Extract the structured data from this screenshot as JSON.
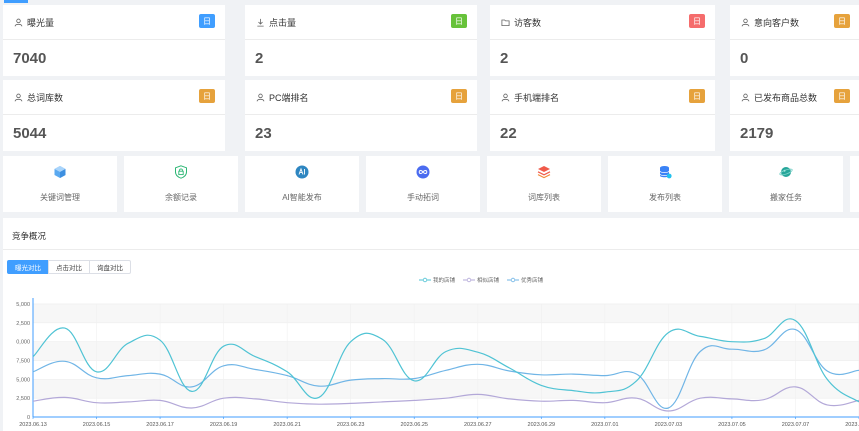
{
  "stats": [
    {
      "label": "曝光量",
      "badge": "日",
      "value": "7040",
      "icon": "user-icon",
      "badge_color": "#409eff"
    },
    {
      "label": "点击量",
      "badge": "日",
      "value": "2",
      "icon": "download-icon",
      "badge_color": "#67c23a"
    },
    {
      "label": "访客数",
      "badge": "日",
      "value": "2",
      "icon": "folder-icon",
      "badge_color": "#f56c6c"
    },
    {
      "label": "意向客户数",
      "badge": "日",
      "value": "0",
      "icon": "user-icon",
      "badge_color": "#e6a23c"
    },
    {
      "label": "总词库数",
      "badge": "日",
      "value": "5044",
      "icon": "user-icon",
      "badge_color": "#e6a23c"
    },
    {
      "label": "PC端排名",
      "badge": "日",
      "value": "23",
      "icon": "user-icon",
      "badge_color": "#e6a23c"
    },
    {
      "label": "手机端排名",
      "badge": "日",
      "value": "22",
      "icon": "user-icon",
      "badge_color": "#e6a23c"
    },
    {
      "label": "已发布商品总数",
      "badge": "日",
      "value": "2179",
      "icon": "user-icon",
      "badge_color": "#e6a23c"
    }
  ],
  "tools": [
    {
      "label": "关键词管理",
      "icon": "cube-icon"
    },
    {
      "label": "余额记录",
      "icon": "shield-lock-icon"
    },
    {
      "label": "AI智能发布",
      "icon": "ai-circle-icon"
    },
    {
      "label": "手动拓词",
      "icon": "infinity-circle-icon"
    },
    {
      "label": "词库列表",
      "icon": "layers-icon"
    },
    {
      "label": "发布列表",
      "icon": "database-icon"
    },
    {
      "label": "搬家任务",
      "icon": "planet-icon"
    }
  ],
  "competition": {
    "title": "竞争概况",
    "tabs": [
      "曝光对比",
      "点击对比",
      "询盘对比"
    ]
  },
  "chart_data": {
    "type": "line",
    "x": [
      "2023.06.13",
      "2023.06.14",
      "2023.06.15",
      "2023.06.16",
      "2023.06.17",
      "2023.06.18",
      "2023.06.19",
      "2023.06.20",
      "2023.06.21",
      "2023.06.22",
      "2023.06.23",
      "2023.06.24",
      "2023.06.25",
      "2023.06.26",
      "2023.06.27",
      "2023.06.28",
      "2023.06.29",
      "2023.06.30",
      "2023.07.01",
      "2023.07.02",
      "2023.07.03",
      "2023.07.04",
      "2023.07.05",
      "2023.07.06",
      "2023.07.07",
      "2023.07.08",
      "2023.07.09"
    ],
    "x_tick_labels": [
      "2023.06.13",
      "2023.06.15",
      "2023.06.17",
      "2023.06.19",
      "2023.06.21",
      "2023.06.23",
      "2023.06.25",
      "2023.06.27",
      "2023.06.29",
      "2023.07.01",
      "2023.07.03",
      "2023.07.05",
      "2023.07.07",
      "2023.07.09"
    ],
    "y_tick_labels": [
      "0",
      "2,500",
      "5,000",
      "7,500",
      "0,000",
      "2,500",
      "5,000"
    ],
    "ylim": [
      0,
      15000
    ],
    "grid": true,
    "legend_position": "top",
    "series": [
      {
        "name": "我的店铺",
        "color": "#4fc3d4",
        "values": [
          8000,
          11800,
          6000,
          9800,
          10200,
          3400,
          9400,
          8000,
          6000,
          2600,
          10000,
          10300,
          4800,
          8700,
          8600,
          6500,
          4200,
          3500,
          3300,
          4800,
          11200,
          10700,
          10000,
          10400,
          12800,
          5000,
          2000
        ]
      },
      {
        "name": "相似店铺",
        "color": "#b3a8d8",
        "values": [
          2100,
          2600,
          1900,
          2000,
          2200,
          1200,
          2500,
          2400,
          1900,
          1700,
          1800,
          2000,
          2200,
          2500,
          3000,
          2400,
          2100,
          2200,
          1900,
          2500,
          800,
          2500,
          2400,
          2300,
          4000,
          1600,
          2200
        ]
      },
      {
        "name": "优秀店铺",
        "color": "#70b5e6",
        "values": [
          6000,
          7400,
          5200,
          5500,
          5700,
          4000,
          6800,
          6300,
          5500,
          4100,
          4900,
          5100,
          5100,
          6200,
          7000,
          6100,
          5600,
          5700,
          5500,
          5700,
          1200,
          8700,
          9000,
          8900,
          11600,
          6100,
          6200
        ]
      }
    ]
  }
}
